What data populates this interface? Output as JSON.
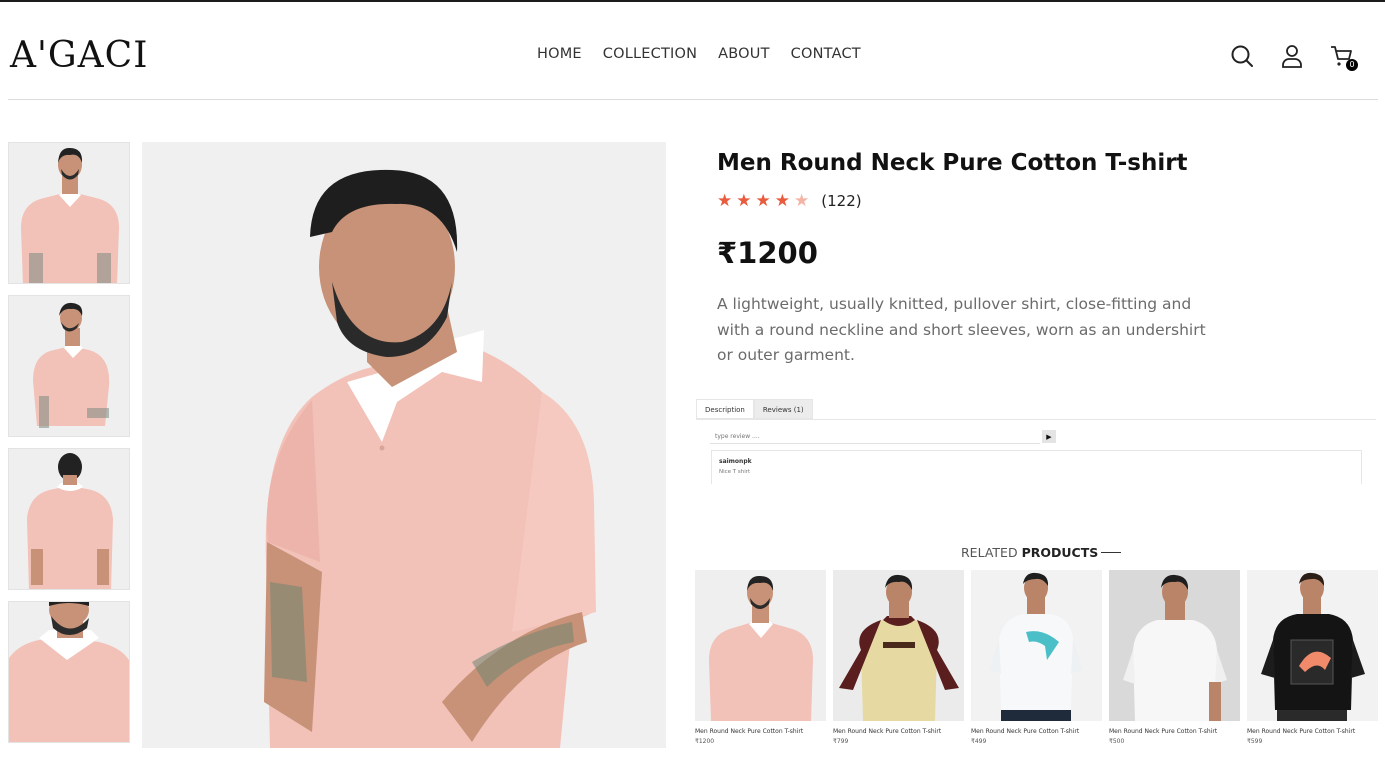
{
  "brand": {
    "logo": "A'GACI"
  },
  "nav": {
    "home": "HOME",
    "collection": "COLLECTION",
    "about": "ABOUT",
    "contact": "CONTACT"
  },
  "header_icons": {
    "search": "search-icon",
    "profile": "user-icon",
    "cart": "cart-icon",
    "cart_count": "0"
  },
  "product": {
    "title": "Men Round Neck Pure Cotton T-shirt",
    "rating": 4,
    "rating_max": 5,
    "review_count": "(122)",
    "price": "₹1200",
    "description": "A lightweight, usually knitted, pullover shirt, close-fitting and with a round neckline and short sleeves, worn as an undershirt or outer garment."
  },
  "tabs": {
    "description": "Description",
    "reviews": "Reviews (1)"
  },
  "review_form": {
    "placeholder": "type review ....",
    "send": "▶"
  },
  "reviews": [
    {
      "user": "saimonpk",
      "text": "Nice T shirt"
    }
  ],
  "related": {
    "heading_light": "RELATED",
    "heading_bold": "PRODUCTS",
    "items": [
      {
        "name": "Men Round Neck Pure Cotton T-shirt",
        "price": "₹1200"
      },
      {
        "name": "Men Round Neck Pure Cotton T-shirt",
        "price": "₹799"
      },
      {
        "name": "Men Round Neck Pure Cotton T-shirt",
        "price": "₹499"
      },
      {
        "name": "Men Round Neck Pure Cotton T-shirt",
        "price": "₹500"
      },
      {
        "name": "Men Round Neck Pure Cotton T-shirt",
        "price": "₹599"
      }
    ]
  },
  "colors": {
    "accent_star": "#ea5a3c",
    "shirt_pink": "#f2c1b8",
    "text_dark": "#111111"
  }
}
